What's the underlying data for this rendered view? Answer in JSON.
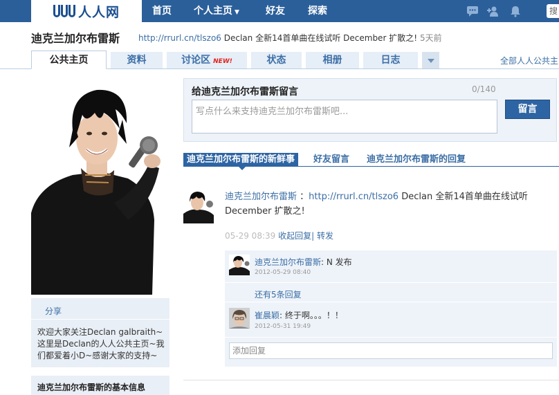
{
  "colors": {
    "nav_bg": "#2b5f9a",
    "link": "#3b6ea5",
    "accent_button": "#2d64a3",
    "panel_bg": "#e9eff6",
    "new_badge": "#e0221a"
  },
  "topnav": {
    "logo_text": "人人网",
    "items": [
      {
        "label": "首页"
      },
      {
        "label": "个人主页"
      },
      {
        "label": "好友"
      },
      {
        "label": "探索"
      }
    ],
    "icons": [
      "chat-icon",
      "add-friend-icon",
      "notification-bell-icon"
    ],
    "search_label": "搜"
  },
  "header": {
    "title": "迪克兰加尔布雷斯",
    "status_link": "http://rrurl.cn/tlszo6",
    "status_text": " Declan 全新14首单曲在线试听  December 扩散之!",
    "status_time": "5天前"
  },
  "tabs": [
    {
      "label": "公共主页",
      "active": true
    },
    {
      "label": "资料"
    },
    {
      "label": "讨论区",
      "badge": "NEW!"
    },
    {
      "label": "状态"
    },
    {
      "label": "相册"
    },
    {
      "label": "日志"
    }
  ],
  "all_pages_link": "全部人人公共主",
  "sidebar": {
    "share_label": "分享",
    "share_text": "欢迎大家关注Declan galbraith~这里是Declan的人人公共主页~我们都爱着小D~感谢大家的支持~",
    "basic_info_title": "迪克兰加尔布雷斯的基本信息"
  },
  "message_box": {
    "title": "给迪克兰加尔布雷斯留言",
    "count": "0/140",
    "placeholder": "写点什么来支持迪克兰加尔布雷斯吧...",
    "button": "留言"
  },
  "feed_tabs": [
    {
      "label": "迪克兰加尔布雷斯的新鲜事",
      "active": true
    },
    {
      "label": "好友留言"
    },
    {
      "label": "迪克兰加尔布雷斯的回复"
    }
  ],
  "post": {
    "author": "迪克兰加尔布雷斯",
    "colon": " ：",
    "link": "http://rrurl.cn/tlszo6",
    "text": " Declan 全新14首单曲在线试听  December 扩散之!",
    "time": "05-29 08:39",
    "actions": [
      "收起回复",
      "转发"
    ]
  },
  "replies": [
    {
      "name": "迪克兰加尔布雷斯",
      "text": ": N 发布",
      "time": "2012-05-29 08:40"
    },
    {
      "name": "崔晨颖",
      "text": ": 终于啊。。。！！",
      "time": "2012-05-31 19:49"
    }
  ],
  "more_replies": "还有5条回复",
  "add_reply_placeholder": "添加回复"
}
